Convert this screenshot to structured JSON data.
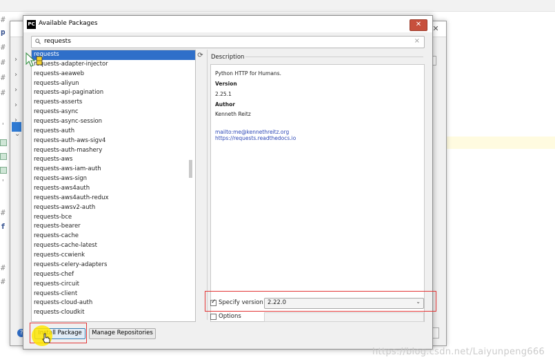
{
  "dialog": {
    "title": "Available Packages",
    "app_icon_text": "PC",
    "close_glyph": "✕"
  },
  "search": {
    "value": "requests",
    "clear_glyph": "×"
  },
  "packages": [
    "requests",
    "requests-adapter-injector",
    "requests-aeaweb",
    "requests-aliyun",
    "requests-api-pagination",
    "requests-asserts",
    "requests-async",
    "requests-async-session",
    "requests-auth",
    "requests-auth-aws-sigv4",
    "requests-auth-mashery",
    "requests-aws",
    "requests-aws-iam-auth",
    "requests-aws-sign",
    "requests-aws4auth",
    "requests-aws4auth-redux",
    "requests-awsv2-auth",
    "requests-bce",
    "requests-bearer",
    "requests-cache",
    "requests-cache-latest",
    "requests-ccwienk",
    "requests-celery-adapters",
    "requests-chef",
    "requests-circuit",
    "requests-client",
    "requests-cloud-auth",
    "requests-cloudkit"
  ],
  "selected_package": "requests",
  "description": {
    "label": "Description",
    "summary": "Python HTTP for Humans.",
    "version_label": "Version",
    "version": "2.25.1",
    "author_label": "Author",
    "author": "Kenneth Reitz",
    "email_link": "mailto:me@kennethreitz.org",
    "home_link": "https://requests.readthedocs.io"
  },
  "specify_version": {
    "label": "Specify version",
    "checked": true,
    "value": "2.22.0"
  },
  "options": {
    "label": "Options",
    "checked": false
  },
  "buttons": {
    "install": "Install Package",
    "manage": "Manage Repositories"
  },
  "watermark": "https://blog.csdn.net/Laiyunpeng666",
  "colors": {
    "selection": "#2f6fc9",
    "highlight_box": "#e23434",
    "link": "#2b46b6",
    "close_button": "#c7503d"
  }
}
